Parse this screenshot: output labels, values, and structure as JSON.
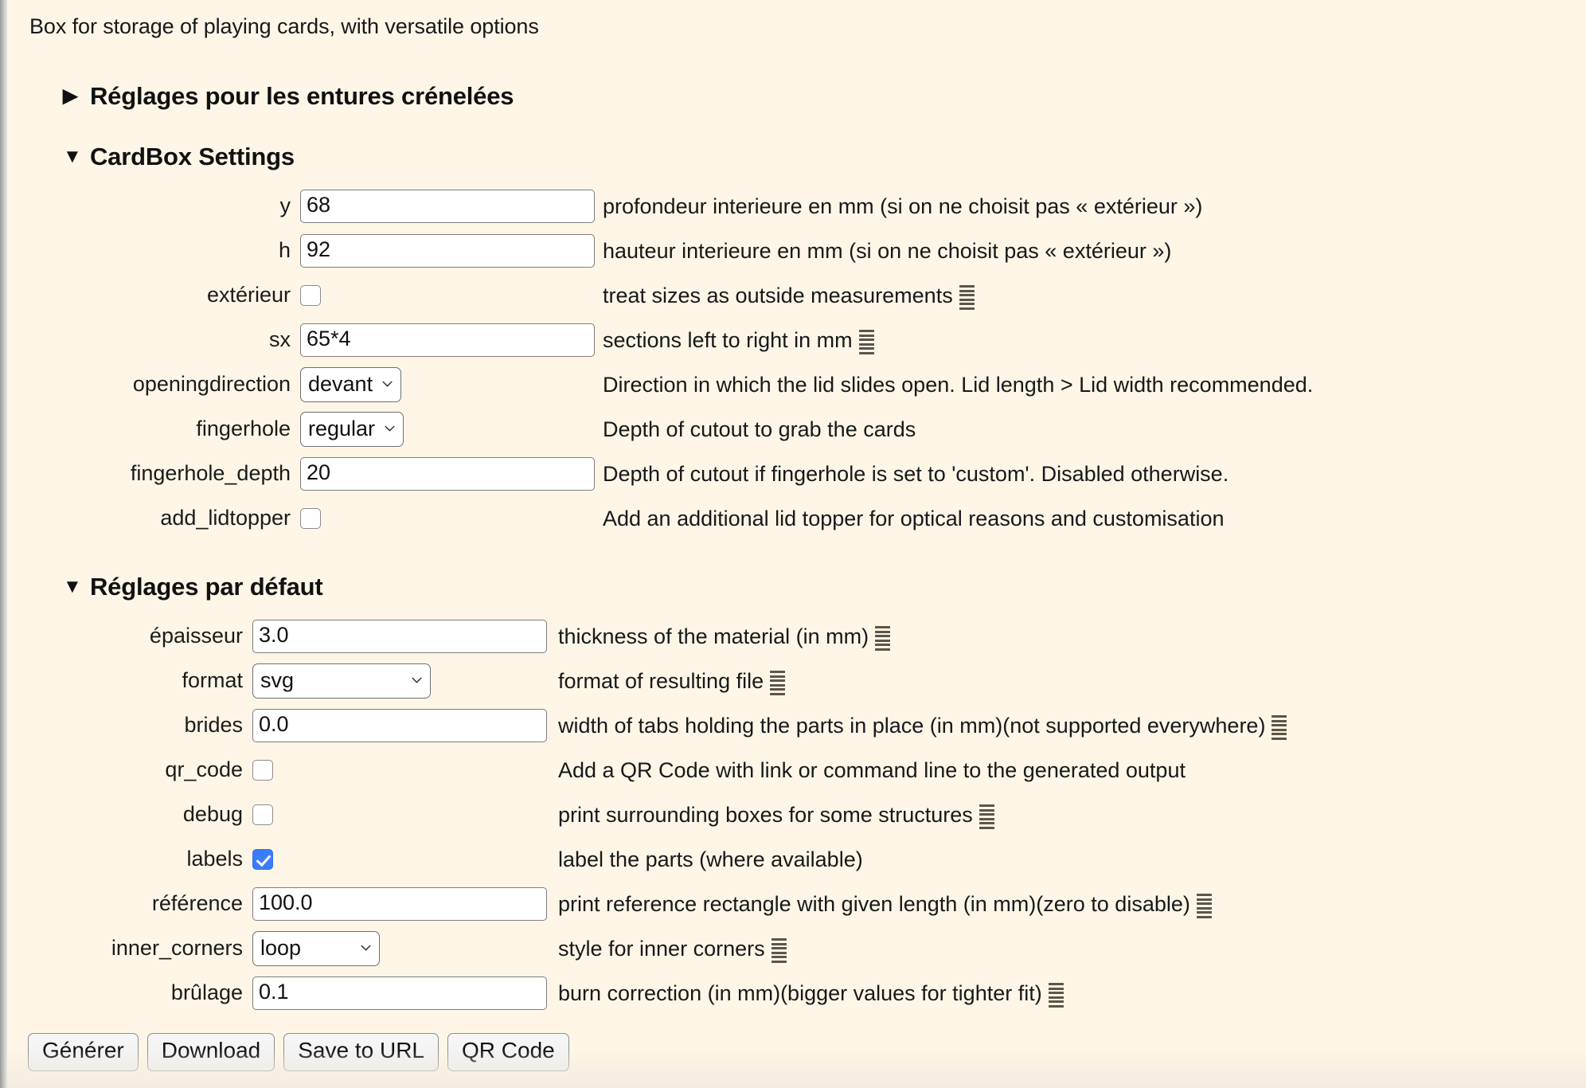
{
  "page": {
    "description": "Box for storage of playing cards, with versatile options",
    "accent_checkbox_color": "#3a7dfb",
    "background_color": "#fdf6e6",
    "doc_icon_color": "#5d5549"
  },
  "sections": {
    "finger_joint": {
      "title": "Réglages pour les entures crénelées",
      "toggle": "▶",
      "expanded": false
    },
    "cardbox": {
      "title": "CardBox Settings",
      "toggle": "▼",
      "expanded": true,
      "rows": [
        {
          "label": "y",
          "type": "text",
          "value": "68",
          "description": "profondeur interieure en mm (si on ne choisit pas « extérieur »)",
          "has_doc_icon": false
        },
        {
          "label": "h",
          "type": "text",
          "value": "92",
          "description": "hauteur interieure en mm (si on ne choisit pas « extérieur »)",
          "has_doc_icon": false
        },
        {
          "label": "extérieur",
          "type": "checkbox",
          "checked": false,
          "description": "treat sizes as outside measurements",
          "has_doc_icon": true
        },
        {
          "label": "sx",
          "type": "text",
          "value": "65*4",
          "description": "sections left to right in mm",
          "has_doc_icon": true
        },
        {
          "label": "openingdirection",
          "type": "select",
          "value": "devant",
          "description": "Direction in which the lid slides open. Lid length > Lid width recommended.",
          "has_doc_icon": false
        },
        {
          "label": "fingerhole",
          "type": "select",
          "value": "regular",
          "description": "Depth of cutout to grab the cards",
          "has_doc_icon": false
        },
        {
          "label": "fingerhole_depth",
          "type": "text",
          "value": "20",
          "description": "Depth of cutout if fingerhole is set to 'custom'. Disabled otherwise.",
          "has_doc_icon": false
        },
        {
          "label": "add_lidtopper",
          "type": "checkbox",
          "checked": false,
          "description": "Add an additional lid topper for optical reasons and customisation",
          "has_doc_icon": false
        }
      ]
    },
    "defaults": {
      "title": "Réglages par défaut",
      "toggle": "▼",
      "expanded": true,
      "rows": [
        {
          "label": "épaisseur",
          "type": "text",
          "value": "3.0",
          "description": "thickness of the material (in mm)",
          "has_doc_icon": true
        },
        {
          "label": "format",
          "type": "select",
          "value": "svg",
          "description": "format of resulting file",
          "has_doc_icon": true
        },
        {
          "label": "brides",
          "type": "text",
          "value": "0.0",
          "description": "width of tabs holding the parts in place (in mm)(not supported everywhere)",
          "has_doc_icon": true
        },
        {
          "label": "qr_code",
          "type": "checkbox",
          "checked": false,
          "description": "Add a QR Code with link or command line to the generated output",
          "has_doc_icon": false
        },
        {
          "label": "debug",
          "type": "checkbox",
          "checked": false,
          "description": "print surrounding boxes for some structures",
          "has_doc_icon": true
        },
        {
          "label": "labels",
          "type": "checkbox",
          "checked": true,
          "description": "label the parts (where available)",
          "has_doc_icon": false
        },
        {
          "label": "référence",
          "type": "text",
          "value": "100.0",
          "description": "print reference rectangle with given length (in mm)(zero to disable)",
          "has_doc_icon": true
        },
        {
          "label": "inner_corners",
          "type": "select",
          "value": "loop",
          "description": "style for inner corners",
          "has_doc_icon": true
        },
        {
          "label": "brûlage",
          "type": "text",
          "value": "0.1",
          "description": "burn correction (in mm)(bigger values for tighter fit)",
          "has_doc_icon": true
        }
      ]
    }
  },
  "buttons": [
    {
      "label": "Générer"
    },
    {
      "label": "Download"
    },
    {
      "label": "Save to URL"
    },
    {
      "label": "QR Code"
    }
  ]
}
